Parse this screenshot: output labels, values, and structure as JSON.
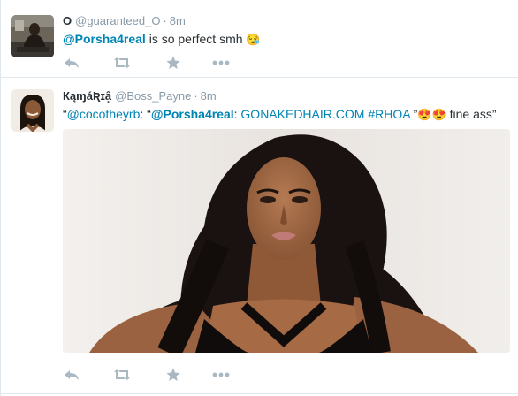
{
  "tweets": [
    {
      "fullname": "O",
      "username": "@guaranteed_O",
      "separator": "·",
      "time": "8m",
      "text_mention": "@Porsha4real",
      "text_rest": " is so perfect smh ",
      "emoji": "😪"
    },
    {
      "fullname": "КąɱáƦɪâ͙",
      "username": "@Boss_Payne",
      "separator": "·",
      "time": "8m",
      "text_open": "“",
      "text_mention1": "@cocotheyrb",
      "text_mid": ": “",
      "text_mention2": "@Porsha4real",
      "text_colon": ": ",
      "text_link": "GONAKEDHAIR.COM",
      "text_space": " ",
      "text_hashtag": "#RHOA",
      "text_quote": " ”",
      "emoji": "😍😍",
      "text_end": " fine ass”"
    }
  ],
  "actions": {
    "reply_icon": "reply-icon",
    "retweet_icon": "retweet-icon",
    "favorite_icon": "star-icon",
    "more_icon": "more-icon"
  },
  "colors": {
    "link": "#0084b4",
    "text": "#292f33",
    "muted": "#8899a6",
    "icon": "#aab8c2",
    "border": "#e1e8ed"
  }
}
